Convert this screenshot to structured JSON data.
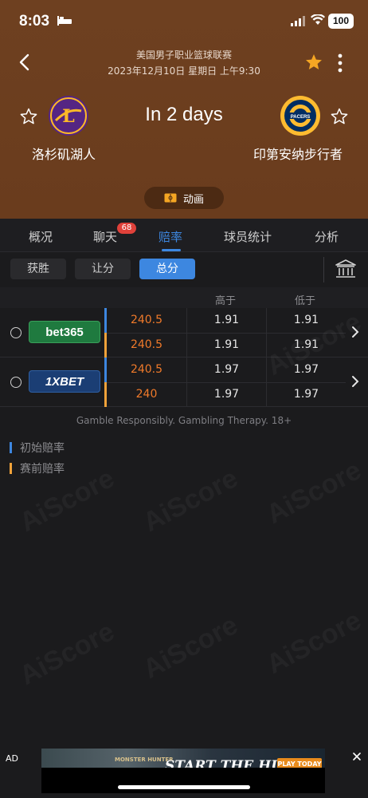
{
  "status_bar": {
    "time": "8:03",
    "battery": "100"
  },
  "header": {
    "league": "美国男子职业篮球联赛",
    "datetime": "2023年12月10日 星期日 上午9:30",
    "countdown": "In 2 days",
    "home_team": "洛杉矶湖人",
    "away_team": "印第安纳步行者",
    "animation_label": "动画",
    "favorite_color": "#f5a623"
  },
  "tabs": [
    {
      "label": "概况"
    },
    {
      "label": "聊天",
      "badge": "68"
    },
    {
      "label": "赔率"
    },
    {
      "label": "球员统计"
    },
    {
      "label": "分析"
    }
  ],
  "active_tab": "赔率",
  "filters": [
    {
      "label": "获胜"
    },
    {
      "label": "让分"
    },
    {
      "label": "总分"
    }
  ],
  "active_filter": "总分",
  "table": {
    "headers": {
      "over": "高于",
      "under": "低于"
    },
    "bookmakers": [
      {
        "name": "bet365",
        "rows": [
          {
            "line": "240.5",
            "over": "1.91",
            "under": "1.91"
          },
          {
            "line": "240.5",
            "over": "1.91",
            "under": "1.91"
          }
        ]
      },
      {
        "name": "1XBET",
        "rows": [
          {
            "line": "240.5",
            "over": "1.97",
            "under": "1.97"
          },
          {
            "line": "240",
            "over": "1.97",
            "under": "1.97"
          }
        ]
      }
    ]
  },
  "disclaimer": "Gamble Responsibly. Gambling Therapy. 18+",
  "legend": {
    "initial": "初始赔率",
    "pregame": "赛前赔率",
    "initial_color": "#3d87e0",
    "pregame_color": "#f0a23a"
  },
  "watermark": "AiScore",
  "ad": {
    "label": "AD",
    "game": "MONSTER HUNTER",
    "title": "START THE HUNT",
    "cta": "PLAY TODAY"
  }
}
